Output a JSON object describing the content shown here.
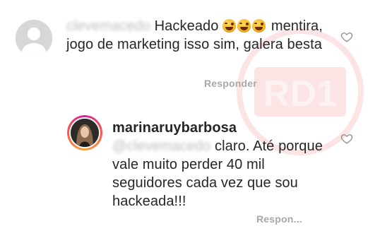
{
  "comments": [
    {
      "username": "clevemacedo",
      "text_line1": "Hackeado",
      "emoji": "rolling-on-floor-laughing",
      "emoji_count": 3,
      "text_rest": "mentira, jogo de marketing isso sim, galera besta",
      "reply_label": "Responder"
    },
    {
      "username": "marinaruybarbosa",
      "mention": "@clevemacedo",
      "text": "claro. Até porque vale muito perder 40 mil seguidores cada vez que sou hackeada!!!",
      "reply_label": "Respon..."
    }
  ],
  "watermark": {
    "label": "RD1",
    "color": "#e43b33"
  }
}
